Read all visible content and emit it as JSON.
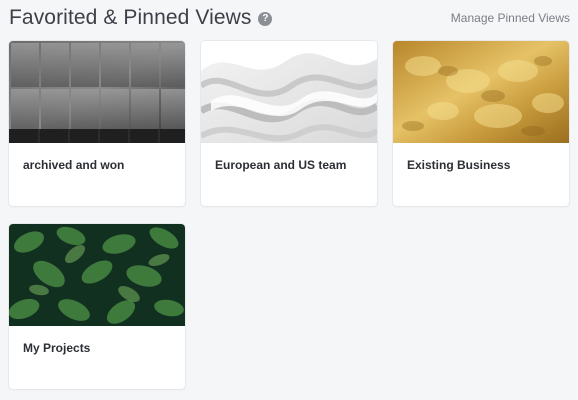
{
  "header": {
    "title": "Favorited & Pinned Views",
    "help_icon_glyph": "?",
    "manage_link": "Manage Pinned Views"
  },
  "views": [
    {
      "label": "archived and won",
      "thumbnail": "steel-panels"
    },
    {
      "label": "European and US team",
      "thumbnail": "white-waves"
    },
    {
      "label": "Existing Business",
      "thumbnail": "gold-foil"
    },
    {
      "label": "My Projects",
      "thumbnail": "green-leaves"
    }
  ]
}
